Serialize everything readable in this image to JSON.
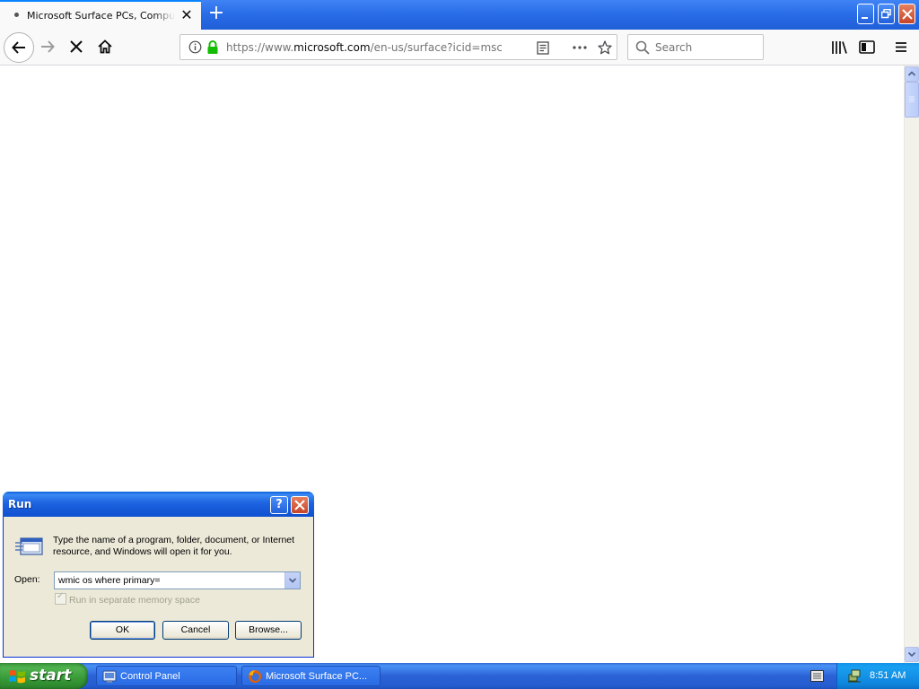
{
  "browser": {
    "tab_title": "Microsoft Surface PCs, Computers",
    "url_prefix": "https://www.",
    "url_domain": "microsoft.com",
    "url_path": "/en-us/surface?icid=mscom",
    "search_placeholder": "Search"
  },
  "run_dialog": {
    "title": "Run",
    "description": "Type the name of a program, folder, document, or Internet resource, and Windows will open it for you.",
    "open_label": "Open:",
    "open_value": "wmic os where primary=",
    "separate_memory_label": "Run in separate memory space",
    "ok_label": "OK",
    "cancel_label": "Cancel",
    "browse_label": "Browse...",
    "help_glyph": "?"
  },
  "taskbar": {
    "start_label": "start",
    "tasks": [
      {
        "label": "Control Panel"
      },
      {
        "label": "Microsoft Surface PC..."
      }
    ],
    "clock": "8:51 AM"
  },
  "colors": {
    "xp_blue": "#245ccf",
    "start_green": "#3c9b3c",
    "firefox_accent": "#0a84ff"
  }
}
